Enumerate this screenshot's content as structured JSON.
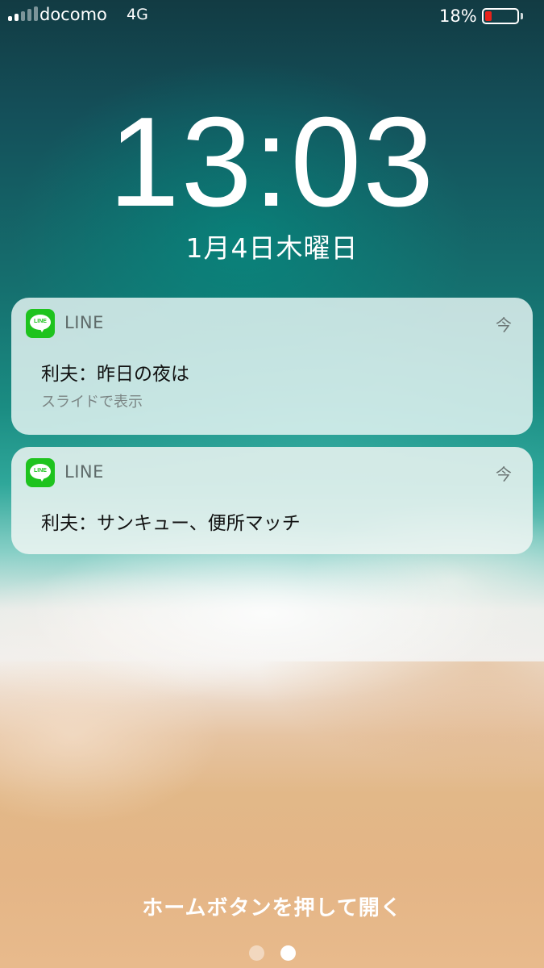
{
  "status_bar": {
    "carrier": "docomo",
    "network": "4G",
    "battery_percent_text": "18%",
    "battery_level": 0.18,
    "battery_color": "#e8221b"
  },
  "lock_screen": {
    "time": "13:03",
    "date": "1月4日木曜日",
    "unlock_hint": "ホームボタンを押して開く",
    "page_count": 2,
    "active_page": 2
  },
  "notifications": [
    {
      "app": "LINE",
      "app_icon": "line-app-icon",
      "app_icon_text": "LINE",
      "time": "今",
      "message": "利夫：昨日の夜は",
      "subtitle": "スライドで表示"
    },
    {
      "app": "LINE",
      "app_icon": "line-app-icon",
      "app_icon_text": "LINE",
      "time": "今",
      "message": "利夫：サンキュー、便所マッチ"
    }
  ],
  "colors": {
    "line_green": "#1ec31e"
  }
}
